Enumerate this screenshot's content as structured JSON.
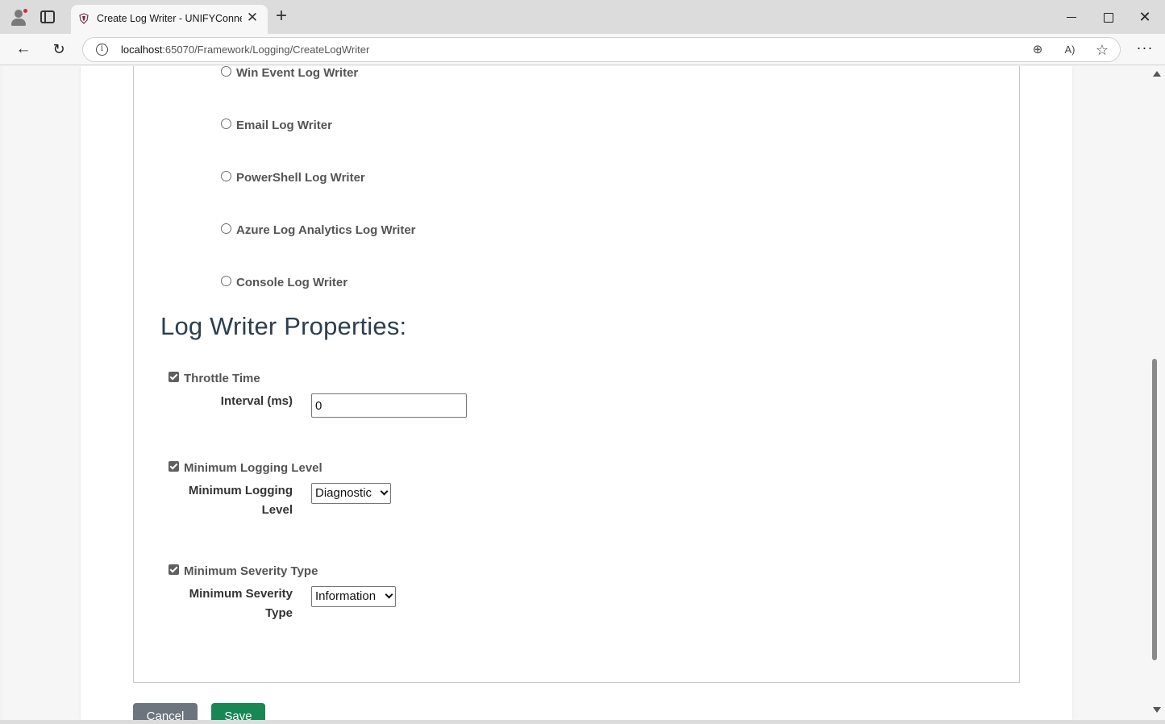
{
  "browser": {
    "tab_title": "Create Log Writer - UNIFYConnect",
    "tab_close": "✕",
    "new_tab": "+",
    "url_host": "localhost",
    "url_rest": ":65070/Framework/Logging/CreateLogWriter",
    "win_close": "✕",
    "back": "←",
    "reload": "↻",
    "info": "i",
    "zoom": "⊕",
    "read_aloud": "A)",
    "favorite": "☆",
    "menu": "···"
  },
  "log_writer_types": [
    {
      "label": "Win Event Log Writer",
      "selected": false
    },
    {
      "label": "Email Log Writer",
      "selected": false
    },
    {
      "label": "PowerShell Log Writer",
      "selected": false
    },
    {
      "label": "Azure Log Analytics Log Writer",
      "selected": false
    },
    {
      "label": "Console Log Writer",
      "selected": false
    }
  ],
  "properties": {
    "title": "Log Writer Properties:",
    "throttle": {
      "label": "Throttle Time",
      "checked": true,
      "field_label": "Interval (ms)",
      "value": "0"
    },
    "min_logging": {
      "label": "Minimum Logging Level",
      "checked": true,
      "field_label_1": "Minimum Logging",
      "field_label_2": "Level",
      "selected": "Diagnostic"
    },
    "min_severity": {
      "label": "Minimum Severity Type",
      "checked": true,
      "field_label_1": "Minimum Severity",
      "field_label_2": "Type",
      "selected": "Information"
    }
  },
  "buttons": {
    "cancel": "Cancel",
    "save": "Save"
  }
}
